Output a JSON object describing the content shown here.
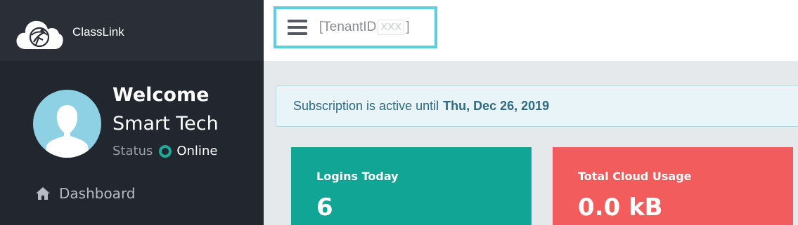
{
  "brand": {
    "name": "ClassLink"
  },
  "user": {
    "welcome": "Welcome",
    "name": "Smart Tech",
    "status_label": "Status",
    "status_value": "Online"
  },
  "nav": {
    "dashboard": "Dashboard"
  },
  "header": {
    "tenant_prefix": "[TenantID",
    "tenant_id": "XXX",
    "tenant_suffix": "]"
  },
  "alert": {
    "text": "Subscription is active until",
    "date": "Thu, Dec 26, 2019"
  },
  "cards": [
    {
      "title": "Logins Today",
      "value": "6",
      "color": "#11a596"
    },
    {
      "title": "Total Cloud Usage",
      "value": "0.0 kB",
      "color": "#f25c5c"
    }
  ],
  "colors": {
    "sidebar": "#22262e",
    "accent_highlight": "#5bcfe0",
    "status_online": "#1fa99a"
  }
}
